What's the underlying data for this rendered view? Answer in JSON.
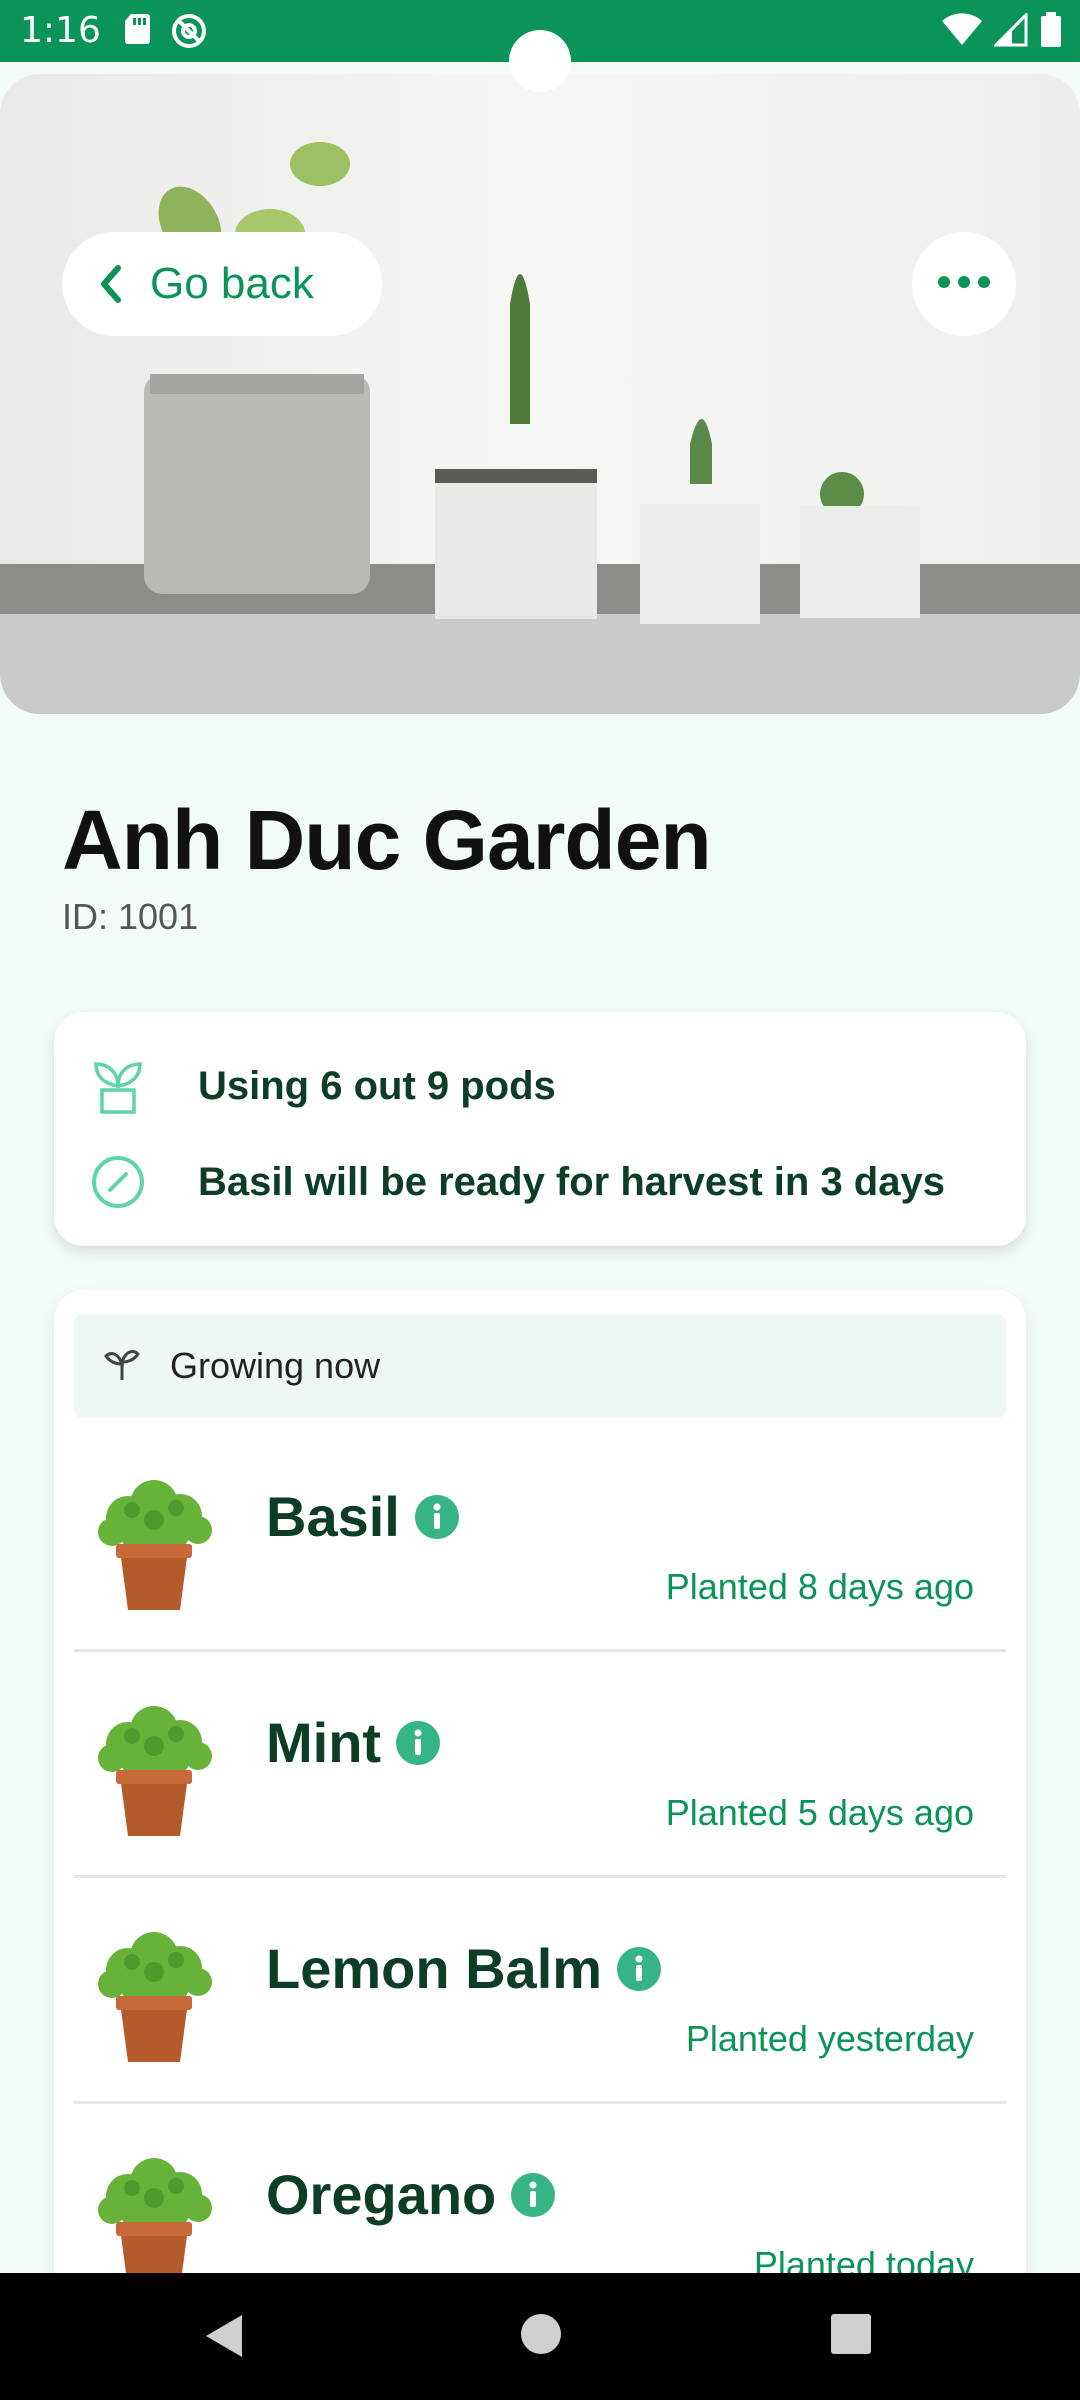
{
  "status_bar": {
    "time": "1:16",
    "icons": [
      "sd-card-icon",
      "at-sign-icon",
      "wifi-icon",
      "signal-icon",
      "battery-icon"
    ],
    "color": "#0a9457"
  },
  "hero": {
    "back_label": "Go back",
    "more_icon": "more-horizontal-icon"
  },
  "garden": {
    "name": "Anh Duc Garden",
    "id_label": "ID:",
    "id_value": "1001"
  },
  "summary": {
    "pods_text": "Using 6 out 9 pods",
    "harvest_text": "Basil will be ready for harvest in 3 days",
    "pods_used": 6,
    "pods_total": 9
  },
  "growing": {
    "header": "Growing now",
    "plants": [
      {
        "name": "Basil",
        "planted": "Planted 8 days ago"
      },
      {
        "name": "Mint",
        "planted": "Planted 5 days ago"
      },
      {
        "name": "Lemon Balm",
        "planted": "Planted yesterday"
      },
      {
        "name": "Oregano",
        "planted": "Planted today"
      }
    ]
  },
  "colors": {
    "accent": "#0a9457",
    "dark_green": "#0c3d26",
    "background": "#f3fbf7"
  }
}
